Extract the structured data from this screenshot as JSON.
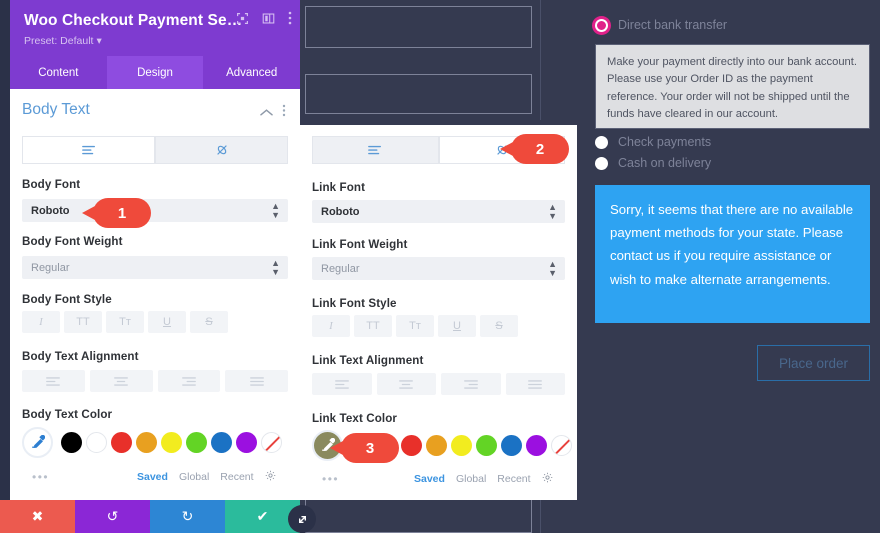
{
  "background": {
    "canvas_color": "#353a50",
    "field_border_color": "#7d8298"
  },
  "checkout_preview": {
    "payment_options": [
      {
        "label": "Direct bank transfer",
        "selected": true
      },
      {
        "label": "Check payments",
        "selected": false
      },
      {
        "label": "Cash on delivery",
        "selected": false
      }
    ],
    "bank_transfer_description": "Make your payment directly into our bank account. Please use your Order ID as the payment reference. Your order will not be shipped until the funds have cleared in our account.",
    "notice": "Sorry, it seems that there are no available payment methods for your state. Please contact us if you require assistance or wish to make alternate arrangements.",
    "notice_color": "#2ea3f2",
    "place_order_label": "Place order",
    "selected_radio_color": "#e0218a"
  },
  "modal": {
    "title": "Woo Checkout Payment Se…",
    "preset": "Preset: Default",
    "preset_caret": "▾",
    "header_color": "#7e3bd0",
    "header_icons": [
      {
        "name": "fullscreen-icon"
      },
      {
        "name": "layout-columns-icon"
      },
      {
        "name": "more-vertical-icon"
      }
    ],
    "tabs": [
      {
        "label": "Content",
        "active": false
      },
      {
        "label": "Design",
        "active": true
      },
      {
        "label": "Advanced",
        "active": false
      }
    ],
    "section": {
      "title": "Body Text",
      "collapse_icon": "chevron-up-icon",
      "menu_icon": "more-vertical-icon"
    },
    "body_panel": {
      "toggle": [
        {
          "name": "text-tab",
          "icon": "text-lines-icon",
          "active": true
        },
        {
          "name": "link-tab",
          "icon": "link-slash-icon",
          "active": false
        }
      ],
      "fields": [
        {
          "label": "Body Font",
          "value": "Roboto",
          "muted": false
        },
        {
          "label": "Body Font Weight",
          "value": "Regular",
          "muted": true
        }
      ],
      "font_style_label": "Body Font Style",
      "font_style_buttons": [
        "I",
        "TT",
        "Tᴛ",
        "U",
        "S"
      ],
      "alignment_label": "Body Text Alignment",
      "alignment_buttons": [
        "align-left",
        "align-center",
        "align-right",
        "align-justify"
      ],
      "color_label": "Body Text Color",
      "picker_icon": "eyedropper-icon",
      "picker_fill": "#ffffff",
      "more_dots": "•••",
      "swatches": [
        "#000000",
        "#ffffff",
        "#e8302a",
        "#e8a020",
        "#f2ec1f",
        "#63d425",
        "#1b72c4",
        "#9b10e0",
        "none"
      ],
      "palette_tabs": [
        {
          "label": "Saved",
          "active": true
        },
        {
          "label": "Global",
          "active": false
        },
        {
          "label": "Recent",
          "active": false
        }
      ],
      "gear_icon": "gear-icon"
    },
    "link_panel": {
      "toggle": [
        {
          "name": "text-tab",
          "icon": "text-lines-icon",
          "active": false
        },
        {
          "name": "link-tab",
          "icon": "link-slash-icon",
          "active": true
        }
      ],
      "fields": [
        {
          "label": "Link Font",
          "value": "Roboto",
          "muted": false
        },
        {
          "label": "Link Font Weight",
          "value": "Regular",
          "muted": true
        }
      ],
      "font_style_label": "Link Font Style",
      "font_style_buttons": [
        "I",
        "TT",
        "Tᴛ",
        "U",
        "S"
      ],
      "alignment_label": "Link Text Alignment",
      "alignment_buttons": [
        "align-left",
        "align-center",
        "align-right",
        "align-justify"
      ],
      "color_label": "Link Text Color",
      "picker_icon": "eyedropper-icon",
      "picker_fill": "#8a8a5e",
      "more_dots": "•••",
      "swatches": [
        "#000000",
        "#ffffff",
        "#e8302a",
        "#e8a020",
        "#f2ec1f",
        "#63d425",
        "#1b72c4",
        "#9b10e0",
        "none"
      ],
      "palette_tabs": [
        {
          "label": "Saved",
          "active": true
        },
        {
          "label": "Global",
          "active": false
        },
        {
          "label": "Recent",
          "active": false
        }
      ],
      "gear_icon": "gear-icon"
    },
    "actions": [
      {
        "name": "cancel-button",
        "icon": "✖",
        "color": "#ec5a4f"
      },
      {
        "name": "undo-button",
        "icon": "↺",
        "color": "#8b27d6"
      },
      {
        "name": "redo-button",
        "icon": "↻",
        "color": "#2d86d4"
      },
      {
        "name": "save-button",
        "icon": "✔",
        "color": "#2bbb9c"
      }
    ],
    "resize_handle_icon": "resize-nwse-icon"
  },
  "callouts": [
    {
      "number": "1",
      "target": "body-font-select"
    },
    {
      "number": "2",
      "target": "link-tab-toggle"
    },
    {
      "number": "3",
      "target": "link-text-color-picker"
    }
  ]
}
